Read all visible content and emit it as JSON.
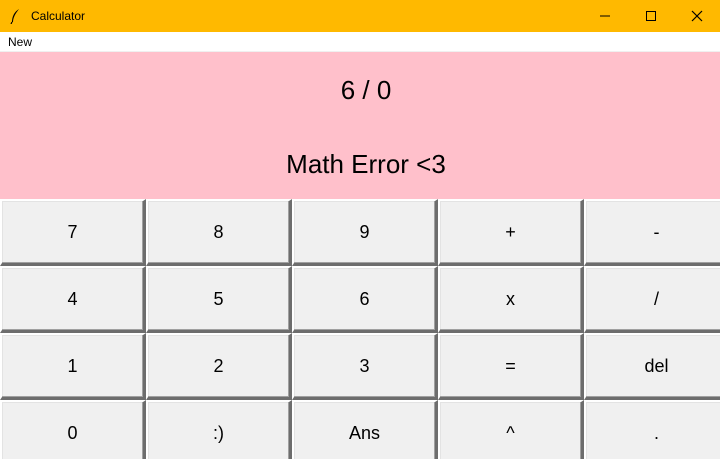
{
  "window": {
    "title": "Calculator",
    "icon": "feather-icon",
    "titlebar_color": "#ffb900"
  },
  "menu": {
    "items": [
      "New"
    ]
  },
  "display": {
    "expression": "6 / 0",
    "result": "Math Error <3",
    "background": "#ffc0cb"
  },
  "keypad": {
    "rows": [
      [
        "7",
        "8",
        "9",
        "+",
        "-"
      ],
      [
        "4",
        "5",
        "6",
        "x",
        "/"
      ],
      [
        "1",
        "2",
        "3",
        "=",
        "del"
      ],
      [
        "0",
        ":)",
        "Ans",
        "^",
        "."
      ]
    ]
  }
}
